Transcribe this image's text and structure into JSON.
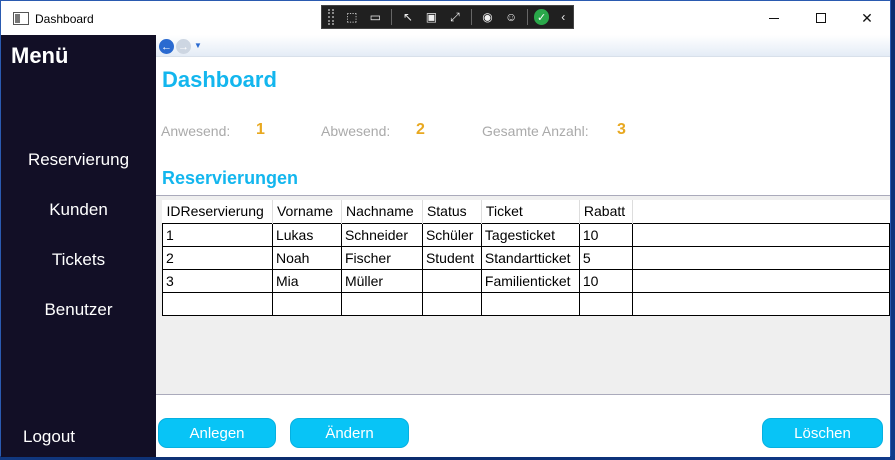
{
  "window": {
    "title": "Dashboard"
  },
  "sidebar": {
    "title": "Menü",
    "items": [
      {
        "label": "Reservierung"
      },
      {
        "label": "Kunden"
      },
      {
        "label": "Tickets"
      },
      {
        "label": "Benutzer"
      }
    ],
    "logout_label": "Logout"
  },
  "main": {
    "title": "Dashboard",
    "stats": [
      {
        "label": "Anwesend:",
        "value": "1"
      },
      {
        "label": "Abwesend:",
        "value": "2"
      },
      {
        "label": "Gesamte Anzahl:",
        "value": "3"
      }
    ],
    "section_title": "Reservierungen",
    "table": {
      "columns": [
        "IDReservierung",
        "Vorname",
        "Nachname",
        "Status",
        "Ticket",
        "Rabatt"
      ],
      "rows": [
        [
          "1",
          "Lukas",
          "Schneider",
          "Schüler",
          "Tagesticket",
          "10"
        ],
        [
          "2",
          "Noah",
          "Fischer",
          "Student",
          "Standartticket",
          "5"
        ],
        [
          "3",
          "Mia",
          "Müller",
          "",
          "Familienticket",
          "10"
        ],
        [
          "",
          "",
          "",
          "",
          "",
          ""
        ]
      ]
    },
    "buttons": {
      "create": "Anlegen",
      "edit": "Ändern",
      "delete": "Löschen"
    }
  },
  "colors": {
    "accent": "#13b6ee",
    "stat_value": "#e8a820",
    "sidebar_bg": "#120f26",
    "button_bg": "#08c4f6"
  }
}
